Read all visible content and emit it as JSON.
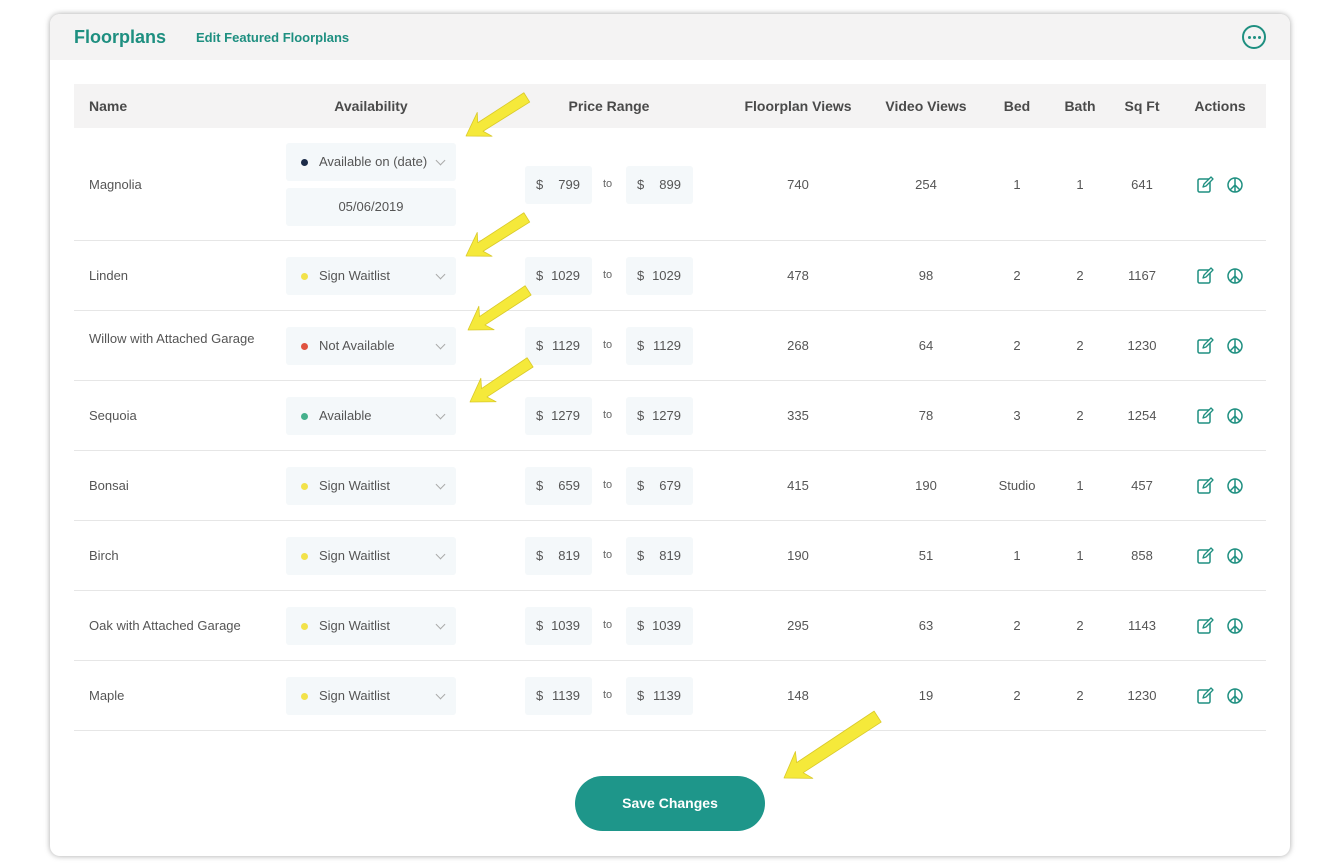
{
  "header": {
    "title": "Floorplans",
    "edit_link": "Edit Featured Floorplans"
  },
  "table": {
    "columns": [
      "Name",
      "Availability",
      "Price Range",
      "Floorplan Views",
      "Video Views",
      "Bed",
      "Bath",
      "Sq Ft",
      "Actions"
    ],
    "price_currency": "$",
    "price_separator": "to",
    "rows": [
      {
        "name": "Magnolia",
        "availability": "Available on (date)",
        "status_color": "#1b2b48",
        "date": "05/06/2019",
        "price_min": "799",
        "price_max": "899",
        "floorplan_views": "740",
        "video_views": "254",
        "bed": "1",
        "bath": "1",
        "sqft": "641"
      },
      {
        "name": "Linden",
        "availability": "Sign Waitlist",
        "status_color": "#f2e24a",
        "price_min": "1029",
        "price_max": "1029",
        "floorplan_views": "478",
        "video_views": "98",
        "bed": "2",
        "bath": "2",
        "sqft": "1167"
      },
      {
        "name": "Willow with Attached Garage",
        "availability": "Not Available",
        "status_color": "#e0533f",
        "price_min": "1129",
        "price_max": "1129",
        "floorplan_views": "268",
        "video_views": "64",
        "bed": "2",
        "bath": "2",
        "sqft": "1230"
      },
      {
        "name": "Sequoia",
        "availability": "Available",
        "status_color": "#45b08c",
        "price_min": "1279",
        "price_max": "1279",
        "floorplan_views": "335",
        "video_views": "78",
        "bed": "3",
        "bath": "2",
        "sqft": "1254"
      },
      {
        "name": "Bonsai",
        "availability": "Sign Waitlist",
        "status_color": "#f2e24a",
        "price_min": "659",
        "price_max": "679",
        "floorplan_views": "415",
        "video_views": "190",
        "bed": "Studio",
        "bath": "1",
        "sqft": "457"
      },
      {
        "name": "Birch",
        "availability": "Sign Waitlist",
        "status_color": "#f2e24a",
        "price_min": "819",
        "price_max": "819",
        "floorplan_views": "190",
        "video_views": "51",
        "bed": "1",
        "bath": "1",
        "sqft": "858"
      },
      {
        "name": "Oak with Attached Garage",
        "availability": "Sign Waitlist",
        "status_color": "#f2e24a",
        "price_min": "1039",
        "price_max": "1039",
        "floorplan_views": "295",
        "video_views": "63",
        "bed": "2",
        "bath": "2",
        "sqft": "1143"
      },
      {
        "name": "Maple",
        "availability": "Sign Waitlist",
        "status_color": "#f2e24a",
        "price_min": "1139",
        "price_max": "1139",
        "floorplan_views": "148",
        "video_views": "19",
        "bed": "2",
        "bath": "2",
        "sqft": "1230"
      }
    ]
  },
  "actions": {
    "edit_icon": "edit-icon",
    "peace_icon": "peace-icon"
  },
  "save_button": "Save Changes",
  "colors": {
    "brand": "#1e8f80",
    "button": "#1e968a",
    "arrow": "#f5e93a"
  }
}
